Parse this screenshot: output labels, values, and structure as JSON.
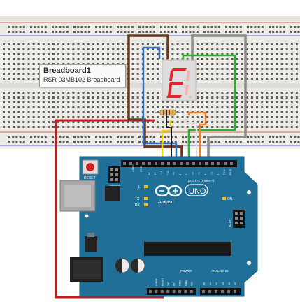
{
  "breadboard": {
    "tooltip_title": "Breadboard1",
    "tooltip_subtitle": "RSR 03MB102 Breadboard"
  },
  "display": {
    "digit": "E"
  },
  "arduino": {
    "reset_label": "RESET",
    "icsp2_label": "ICSP2",
    "aref_label": "AREF",
    "gnd_label": "GND",
    "digital_pins": [
      "13",
      "12",
      "~11",
      "~10",
      "~9",
      "8",
      "7",
      "~6",
      "~5",
      "4",
      "~3",
      "2",
      "TX 1",
      "RX 0"
    ],
    "digital_label": "DIGITAL (PWM=~)",
    "l_label": "L",
    "tx_label": "TX",
    "rx_label": "RX",
    "on_label": "ON",
    "brand": "Arduino",
    "model": "UNO",
    "icsp_label": "ICSP",
    "power_label": "POWER",
    "power_pins": [
      "IOREF",
      "RESET",
      "3V3",
      "5V",
      "GND",
      "GND",
      "VIN"
    ],
    "analog_label": "ANALOG IN",
    "analog_pins": [
      "A0",
      "A1",
      "A2",
      "A3",
      "A4",
      "A5"
    ]
  },
  "colors": {
    "board": "#1f6f98",
    "wire_brown": "#6b3a1e",
    "wire_blue": "#2a73c9",
    "wire_gray": "#8a8a8a",
    "wire_green": "#22b525",
    "wire_red": "#c81a1a",
    "wire_yellow": "#f2d40a",
    "wire_orange": "#f07d1c",
    "segment_on": "#e8242a"
  }
}
